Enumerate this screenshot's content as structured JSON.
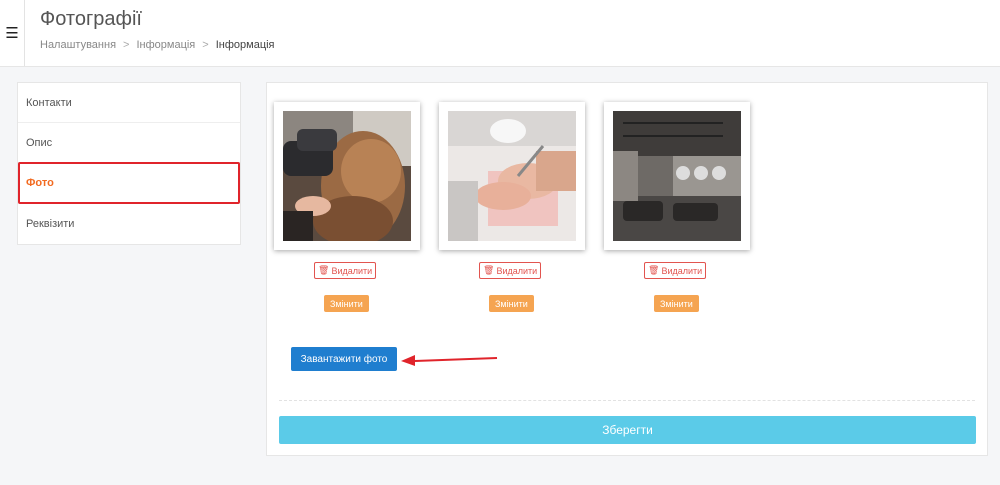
{
  "header": {
    "menu_icon": "hamburger-icon",
    "title": "Фотографії",
    "breadcrumb": [
      "Налаштування",
      "Інформація",
      "Інформація"
    ],
    "separator": ">"
  },
  "sidebar": {
    "items": [
      {
        "label": "Контакти"
      },
      {
        "label": "Опис"
      },
      {
        "label": "Фото"
      },
      {
        "label": "Реквізити"
      }
    ],
    "active_index": 2
  },
  "photos": [
    {
      "delete_label": "Видалити",
      "change_label": "Змінити",
      "delete_icon": "trash-icon"
    },
    {
      "delete_label": "Видалити",
      "change_label": "Змінити",
      "delete_icon": "trash-icon"
    },
    {
      "delete_label": "Видалити",
      "change_label": "Змінити",
      "delete_icon": "trash-icon"
    }
  ],
  "upload": {
    "label": "Завантажити фото"
  },
  "save": {
    "label": "Зберегти"
  },
  "colors": {
    "active_item": "#f26b21",
    "highlight_border": "#e0242b",
    "delete": "#e2544f",
    "change": "#f5a451",
    "upload": "#1f7ecf",
    "save": "#5bcbe8",
    "arrow": "#e0242b"
  }
}
